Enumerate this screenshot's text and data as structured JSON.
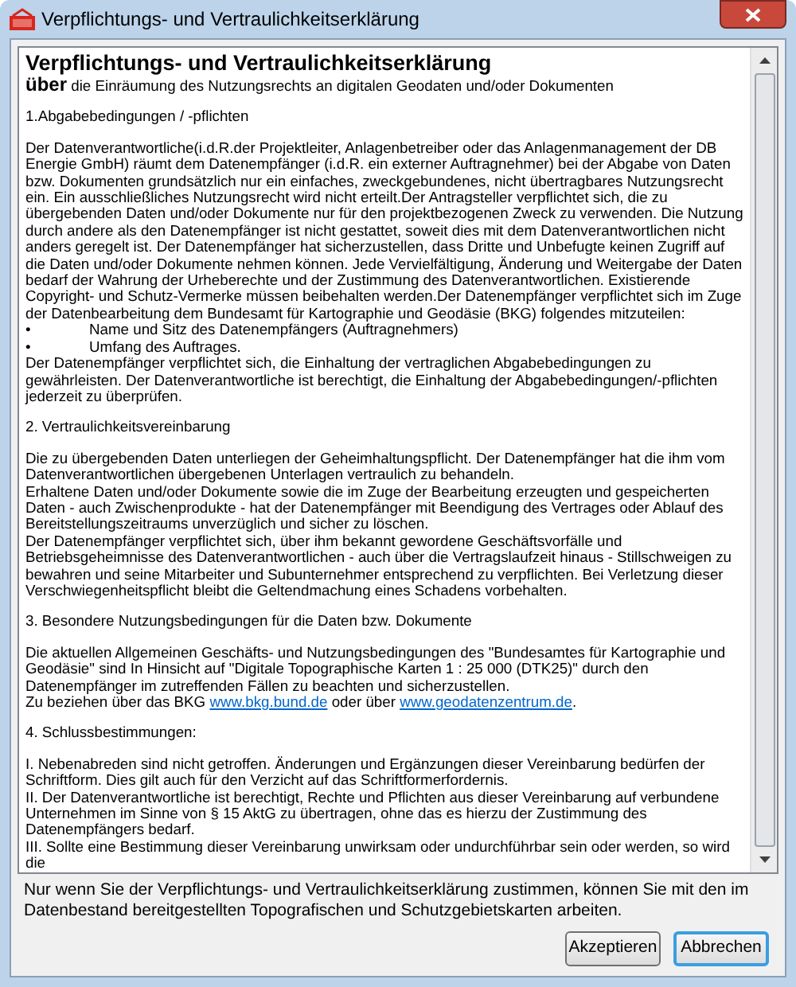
{
  "window": {
    "title": "Verpflichtungs- und Vertraulichkeitserklärung"
  },
  "document": {
    "heading": "Verpflichtungs- und Vertraulichkeitserklärung",
    "subheading": "**über** die Einräumung des Nutzungsrechts an digitalen Geodaten und/oder Dokumenten",
    "blocks": [
      {
        "kind": "section",
        "text": "1.Abgabebedingungen / -pflichten"
      },
      {
        "kind": "paragraph",
        "text": "Der Datenverantwortliche(i.d.R.der Projektleiter, Anlagenbetreiber oder das Anlagenmanagement der DB Energie GmbH) räumt dem Datenempfänger (i.d.R. ein externer Auftragnehmer) bei der Abgabe von Daten bzw. Dokumenten grundsätzlich nur ein einfaches, zweckgebundenes, nicht übertragbares Nutzungsrecht ein. Ein ausschließliches Nutzungsrecht wird nicht erteilt.Der Antragsteller verpflichtet sich, die zu übergebenden Daten und/oder Dokumente nur für den projektbezogenen Zweck zu verwenden. Die Nutzung durch andere als den Datenempfänger ist nicht gestattet, soweit dies mit dem Datenverantwortlichen nicht anders geregelt ist. Der Datenempfänger hat sicherzustellen, dass Dritte und Unbefugte keinen Zugriff auf die Daten und/oder Dokumente nehmen können. Jede Vervielfältigung, Änderung und Weitergabe der Daten bedarf der Wahrung der Urheberechte und der Zustimmung des Datenverantwortlichen. Existierende Copyright- und Schutz-Vermerke müssen beibehalten werden.Der Datenempfänger verpflichtet sich im Zuge der Datenbearbeitung dem Bundesamt für Kartographie und Geodäsie (BKG) folgendes mitzuteilen:"
      },
      {
        "kind": "bullet",
        "marker": "•",
        "text": "Name und Sitz des Datenempfängers (Auftragnehmers)"
      },
      {
        "kind": "bullet",
        "marker": "•",
        "text": "Umfang des Auftrages."
      },
      {
        "kind": "paragraph",
        "text": "Der Datenempfänger verpflichtet sich, die Einhaltung der vertraglichen Abgabebedingungen zu gewährleisten. Der Datenverantwortliche ist berechtigt, die Einhaltung der Abgabebedingungen/-pflichten jederzeit zu überprüfen."
      },
      {
        "kind": "section",
        "text": "2. Vertraulichkeitsvereinbarung"
      },
      {
        "kind": "paragraph",
        "text": "Die zu übergebenden Daten unterliegen der Geheimhaltungspflicht. Der Datenempfänger hat die ihm vom Datenverantwortlichen übergebenen Unterlagen vertraulich zu behandeln."
      },
      {
        "kind": "paragraph",
        "text": "Erhaltene Daten und/oder Dokumente sowie die im Zuge der Bearbeitung erzeugten und gespeicherten Daten - auch Zwischenprodukte - hat der Datenempfänger mit Beendigung des Vertrages oder Ablauf des Bereitstellungszeitraums unverzüglich und sicher zu löschen."
      },
      {
        "kind": "paragraph",
        "text": "Der Datenempfänger verpflichtet sich, über ihm bekannt gewordene Geschäftsvorfälle und Betriebsgeheimnisse des Datenverantwortlichen - auch über die Vertragslaufzeit hinaus - Stillschweigen zu bewahren und seine Mitarbeiter und Subunternehmer entsprechend zu verpflichten. Bei Verletzung dieser Verschwiegenheitspflicht bleibt die Geltendmachung eines Schadens vorbehalten."
      },
      {
        "kind": "section",
        "text": "3. Besondere Nutzungsbedingungen für die Daten bzw. Dokumente"
      },
      {
        "kind": "paragraph",
        "text": "Die aktuellen Allgemeinen Geschäfts- und Nutzungsbedingungen des \"Bundesamtes für Kartographie und Geodäsie\" sind In Hinsicht auf \"Digitale Topographische Karten 1 : 25 000 (DTK25)\" durch den Datenempfänger im zutreffenden Fällen zu beachten und sicherzustellen."
      },
      {
        "kind": "links",
        "parts": [
          {
            "kind": "text",
            "text": "Zu beziehen über das BKG "
          },
          {
            "kind": "link",
            "text": "www.bkg.bund.de"
          },
          {
            "kind": "text",
            "text": " oder über "
          },
          {
            "kind": "link",
            "text": "www.geodatenzentrum.de"
          },
          {
            "kind": "text",
            "text": "."
          }
        ]
      },
      {
        "kind": "section",
        "text": "4. Schlussbestimmungen:"
      },
      {
        "kind": "paragraph",
        "text": "I. Nebenabreden sind nicht getroffen. Änderungen und Ergänzungen dieser Vereinbarung bedürfen der Schriftform. Dies gilt auch für den Verzicht auf das Schriftformerfordernis."
      },
      {
        "kind": "paragraph",
        "text": "II. Der Datenverantwortliche ist berechtigt, Rechte und Pflichten aus dieser Vereinbarung auf verbundene Unternehmen im Sinne von § 15 AktG zu übertragen, ohne das es hierzu der Zustimmung des Datenempfängers bedarf."
      },
      {
        "kind": "paragraph",
        "text": "III. Sollte eine Bestimmung dieser Vereinbarung unwirksam oder undurchführbar sein oder werden, so wird die"
      }
    ]
  },
  "note": "Nur wenn Sie der Verpflichtungs- und Vertraulichkeitserklärung zustimmen, können Sie mit den im Datenbestand bereitgestellten Topografischen und Schutzgebietskarten arbeiten.",
  "buttons": [
    {
      "label": "Akzeptieren",
      "selected": false
    },
    {
      "label": "Abbrechen",
      "selected": true
    }
  ]
}
